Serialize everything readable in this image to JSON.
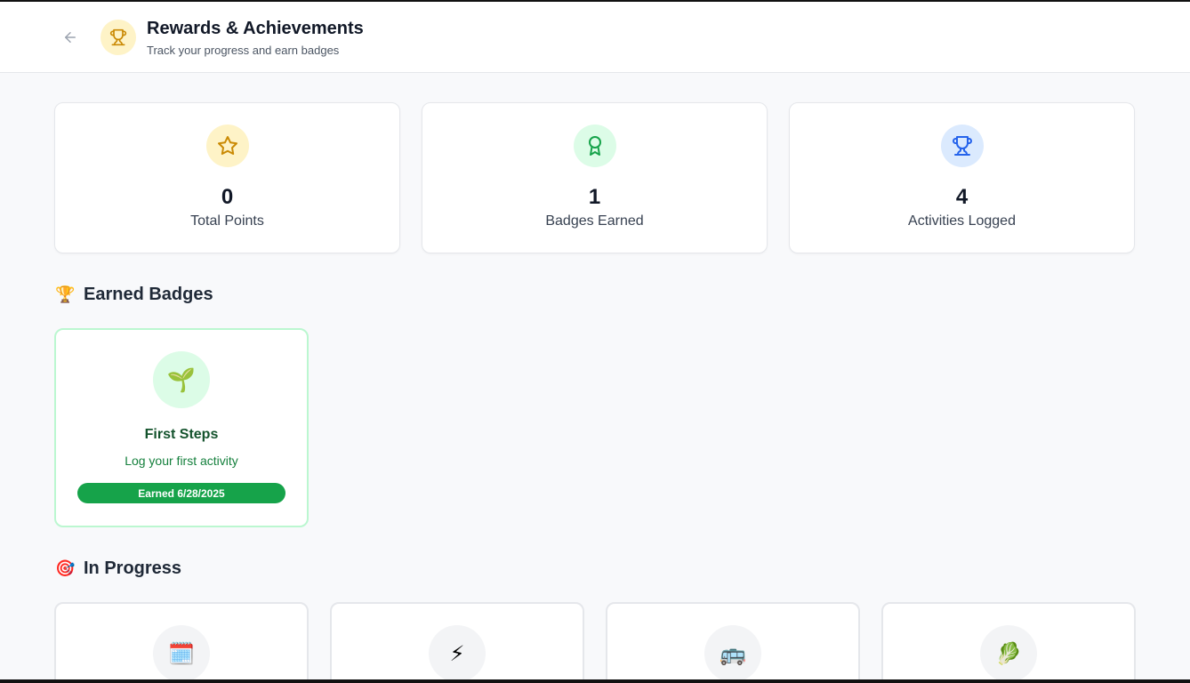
{
  "header": {
    "title": "Rewards & Achievements",
    "subtitle": "Track your progress and earn badges",
    "back_icon": "arrow-left-icon",
    "header_icon": "trophy-icon"
  },
  "stats": [
    {
      "value": "0",
      "label": "Total Points",
      "icon": "star-icon",
      "icon_bg": "#fef3c7",
      "icon_color": "#ca8a04"
    },
    {
      "value": "1",
      "label": "Badges Earned",
      "icon": "award-icon",
      "icon_bg": "#dcfce7",
      "icon_color": "#16a34a"
    },
    {
      "value": "4",
      "label": "Activities Logged",
      "icon": "trophy-icon",
      "icon_bg": "#dbeafe",
      "icon_color": "#2563eb"
    }
  ],
  "earned_section": {
    "emoji": "🏆",
    "title": "Earned Badges"
  },
  "earned_badges": [
    {
      "emoji": "🌱",
      "name": "First Steps",
      "description": "Log your first activity",
      "earned_label": "Earned 6/28/2025"
    }
  ],
  "progress_section": {
    "emoji": "🎯",
    "title": "In Progress"
  },
  "progress_badges": [
    {
      "emoji": "🗓️",
      "icon": "calendar-icon"
    },
    {
      "emoji": "⚡",
      "icon": "lightning-icon"
    },
    {
      "emoji": "🚌",
      "icon": "bus-icon"
    },
    {
      "emoji": "🥬",
      "icon": "leafy-green-icon"
    }
  ],
  "colors": {
    "accent_green": "#16a34a",
    "page_bg": "#f8f9fb"
  }
}
